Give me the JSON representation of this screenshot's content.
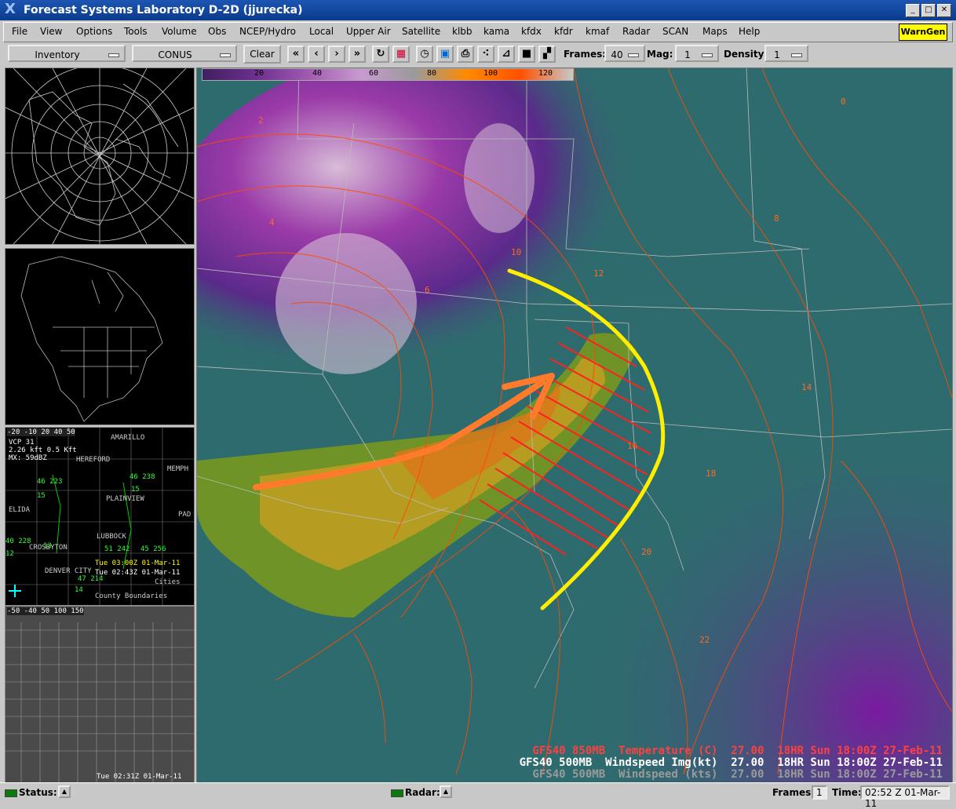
{
  "window": {
    "title": "Forecast Systems Laboratory D-2D (jjurecka)"
  },
  "menu": {
    "items": [
      "File",
      "View",
      "Options",
      "Tools",
      "Volume",
      "Obs",
      "NCEP/Hydro",
      "Local",
      "Upper Air",
      "Satellite",
      "klbb",
      "kama",
      "kfdx",
      "kfdr",
      "kmaf",
      "Radar",
      "SCAN",
      "Maps",
      "Help"
    ],
    "warngen": "WarnGen"
  },
  "toolbar": {
    "inventory": "Inventory",
    "region": "CONUS",
    "clear": "Clear",
    "frames_label": "Frames:",
    "frames_value": "40",
    "mag_label": "Mag:",
    "mag_value": "1",
    "density_label": "Density:",
    "density_value": "1"
  },
  "panel3": {
    "scale": "-20 -10 20 40 50",
    "vcp": "VCP 31",
    "tilt": "2.26 kft 0.5 Kft",
    "mx": "MX: 59dBZ",
    "places": [
      "AMARILLO",
      "HEREFORD",
      "MEMPH",
      "PLAINVIEW",
      "ELIDA",
      "PAD",
      "LUBBOCK",
      "CROSBYTON",
      "DENVER CITY"
    ],
    "time1": "Tue 03:00Z 01-Mar-11",
    "time2": "Tue 02:43Z 01-Mar-11",
    "cities": "Cities",
    "county": "County Boundaries",
    "obs": [
      "46 223",
      "46 238",
      "15",
      "15",
      "40 228",
      "13",
      "51 242",
      "45 256",
      "47 214",
      "14",
      "12"
    ]
  },
  "panel4": {
    "scale": "-50 -40 50 100 150",
    "time": "Tue 02:31Z 01-Mar-11"
  },
  "mainmap": {
    "colorbar_ticks": [
      "20",
      "40",
      "60",
      "80",
      "100",
      "120"
    ],
    "legend": [
      {
        "text": "GFS40 850MB  Temperature (C)  27.00  18HR Sun 18:00Z 27-Feb-11",
        "color": "#ff4040"
      },
      {
        "text": "GFS40 500MB  Windspeed Img(kt)  27.00  18HR Sun 18:00Z 27-Feb-11",
        "color": "#ffffff"
      },
      {
        "text": "GFS40 500MB  Windspeed (kts)  27.00  18HR Sun 18:00Z 27-Feb-11",
        "color": "#9a9a9a"
      }
    ],
    "contour_labels": [
      "0",
      "2",
      "4",
      "6",
      "8",
      "10",
      "12",
      "14",
      "16",
      "18",
      "20",
      "22"
    ]
  },
  "status": {
    "status_label": "Status:",
    "radar_label": "Radar:",
    "frames_label": "Frames:",
    "frames_value": "1",
    "time_label": "Time:",
    "time_value": "02:52 Z 01-Mar-11"
  },
  "colors": {
    "warngen": "#ffff00",
    "annotation_arc": "#ffff00",
    "annotation_arrow": "#ff7a2a",
    "hatch": "#ff2020",
    "contour": "#ff4a00"
  }
}
